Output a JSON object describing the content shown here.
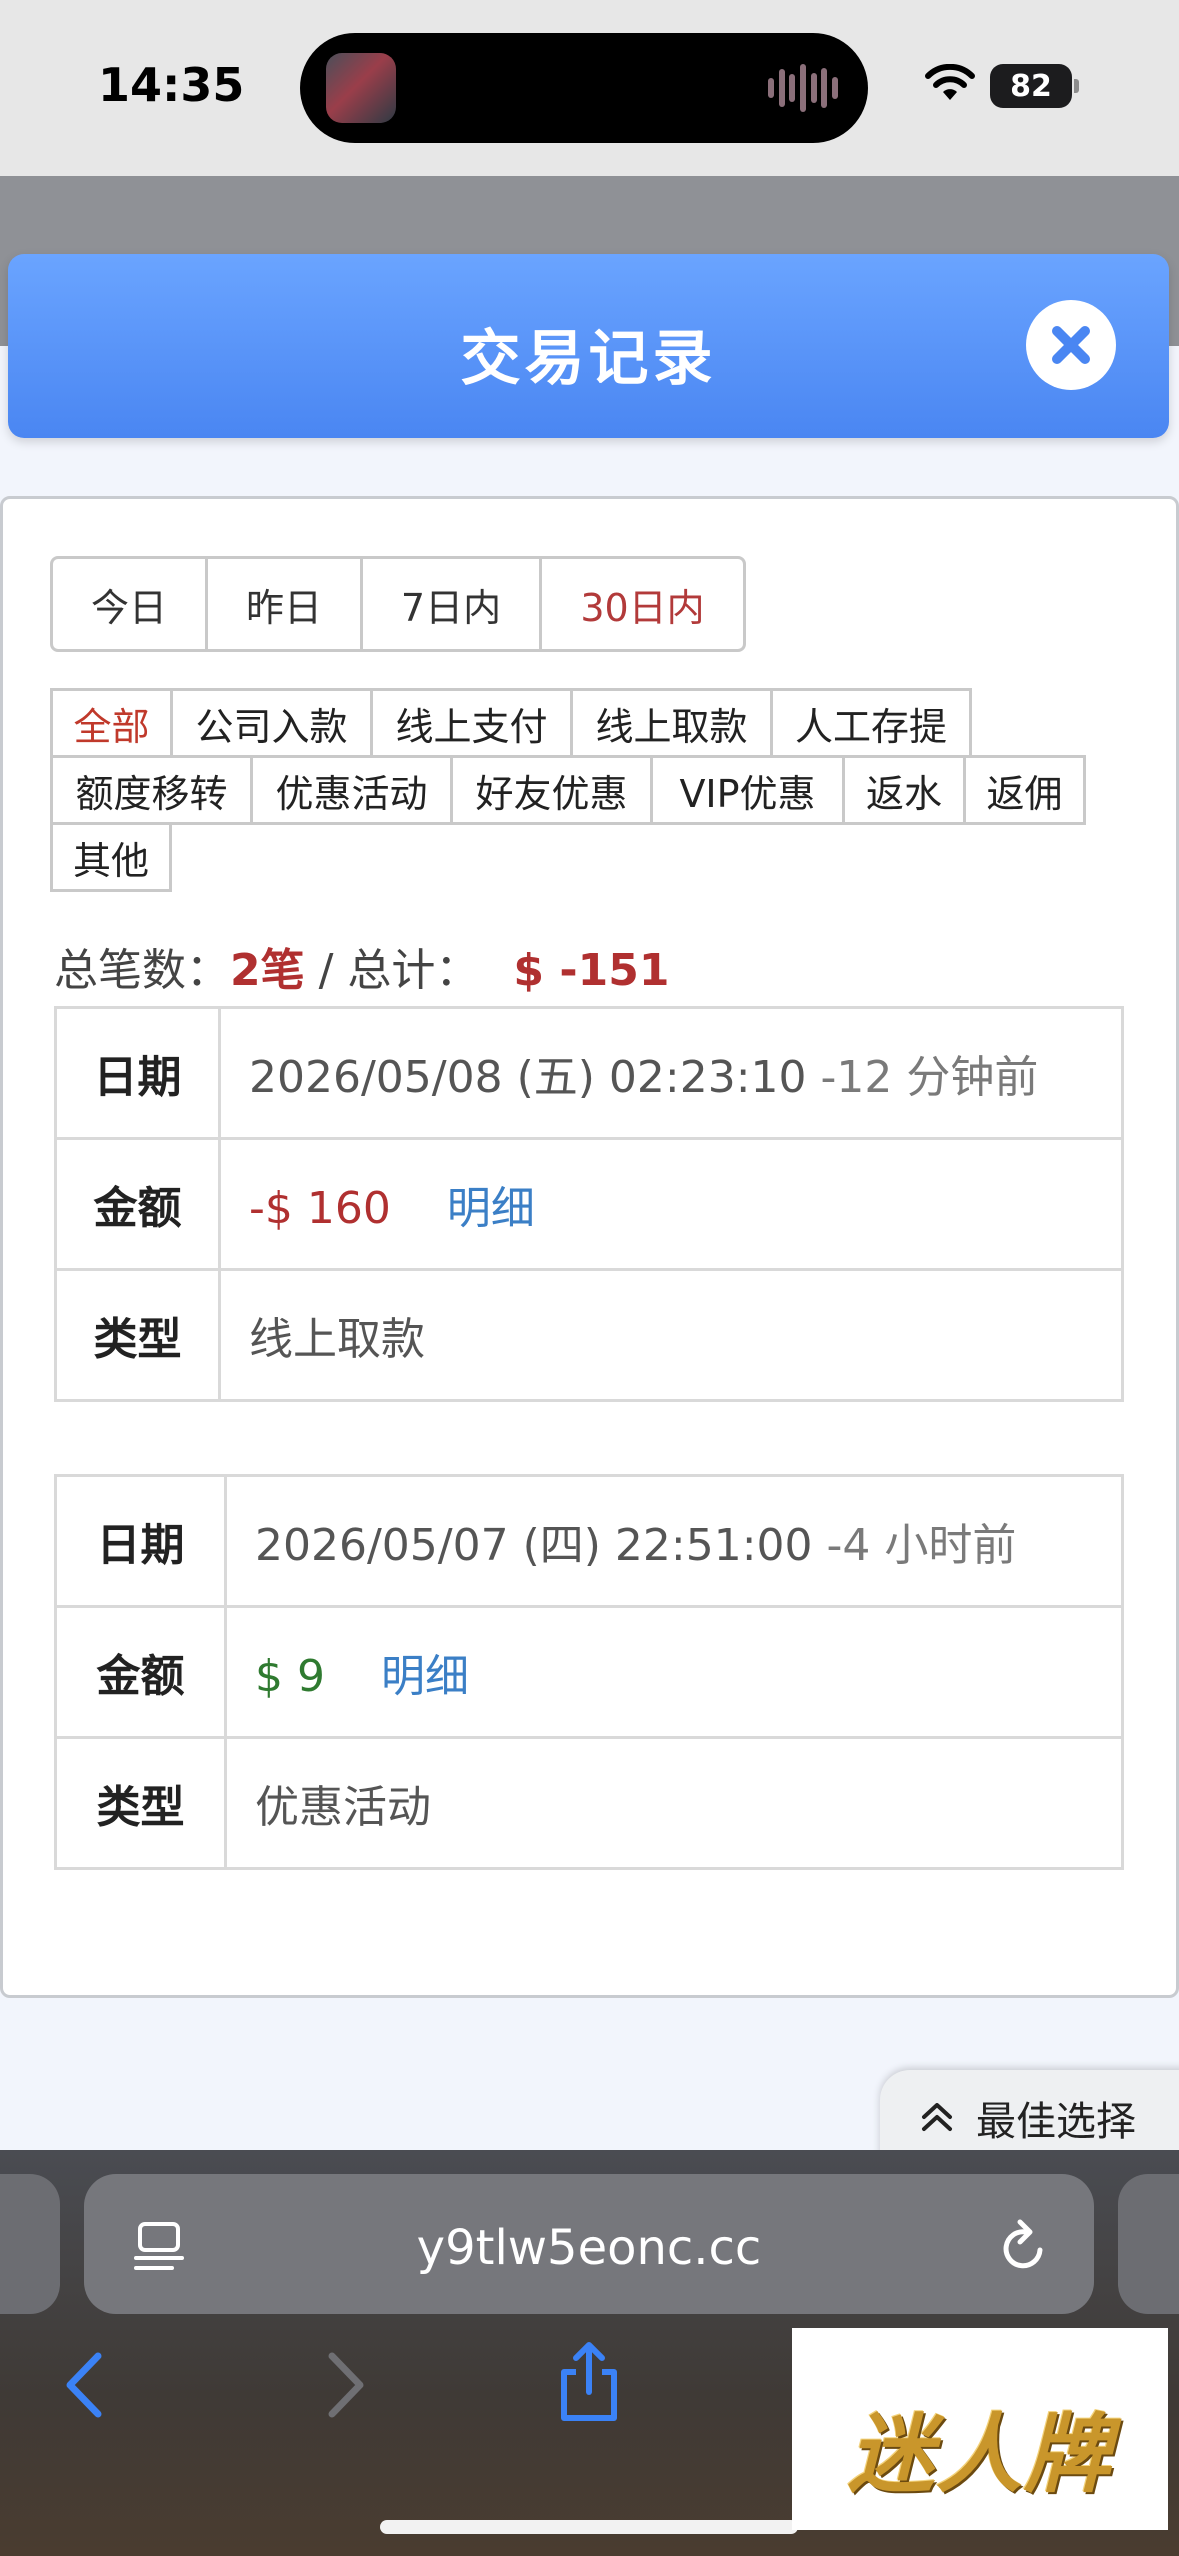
{
  "status_bar": {
    "time": "14:35",
    "battery": "82"
  },
  "modal": {
    "title": "交易记录"
  },
  "range_tabs": [
    {
      "label": "今日",
      "active": false
    },
    {
      "label": "昨日",
      "active": false
    },
    {
      "label": "7日内",
      "active": false
    },
    {
      "label": "30日内",
      "active": true
    }
  ],
  "type_tabs": [
    [
      {
        "label": "全部",
        "active": true
      },
      {
        "label": "公司入款",
        "active": false
      },
      {
        "label": "线上支付",
        "active": false
      },
      {
        "label": "线上取款",
        "active": false
      },
      {
        "label": "人工存提",
        "active": false
      }
    ],
    [
      {
        "label": "额度移转",
        "active": false
      },
      {
        "label": "优惠活动",
        "active": false
      },
      {
        "label": "好友优惠",
        "active": false
      },
      {
        "label": "VIP优惠",
        "active": false
      },
      {
        "label": "返水",
        "active": false
      },
      {
        "label": "返佣",
        "active": false
      }
    ],
    [
      {
        "label": "其他",
        "active": false
      }
    ]
  ],
  "summary": {
    "count_label": "总笔数：",
    "count": "2笔",
    "separator": " / 总计：",
    "total": "$ -151"
  },
  "records": [
    {
      "date_label": "日期",
      "date": "2026/05/08 (五) 02:23:10",
      "ago": " -12 分钟前",
      "amount_label": "金额",
      "amount": "-$ 160",
      "amount_sign": "neg",
      "detail": "明细",
      "type_label": "类型",
      "type": "线上取款"
    },
    {
      "date_label": "日期",
      "date": "2026/05/07 (四) 22:51:00",
      "ago": " -4 小时前",
      "amount_label": "金额",
      "amount": "$ 9",
      "amount_sign": "pos",
      "detail": "明细",
      "type_label": "类型",
      "type": "优惠活动"
    }
  ],
  "floating_button": {
    "label": "最佳选择",
    "icon": "chevron-up-double-icon"
  },
  "browser": {
    "url": "y9tlw5eonc.cc"
  },
  "watermark": {
    "text": "迷人牌"
  },
  "colors": {
    "header_blue": "#4a86f2",
    "active_red": "#b23a3a",
    "positive_green": "#2f7a30",
    "link_blue": "#3b7fc6"
  }
}
